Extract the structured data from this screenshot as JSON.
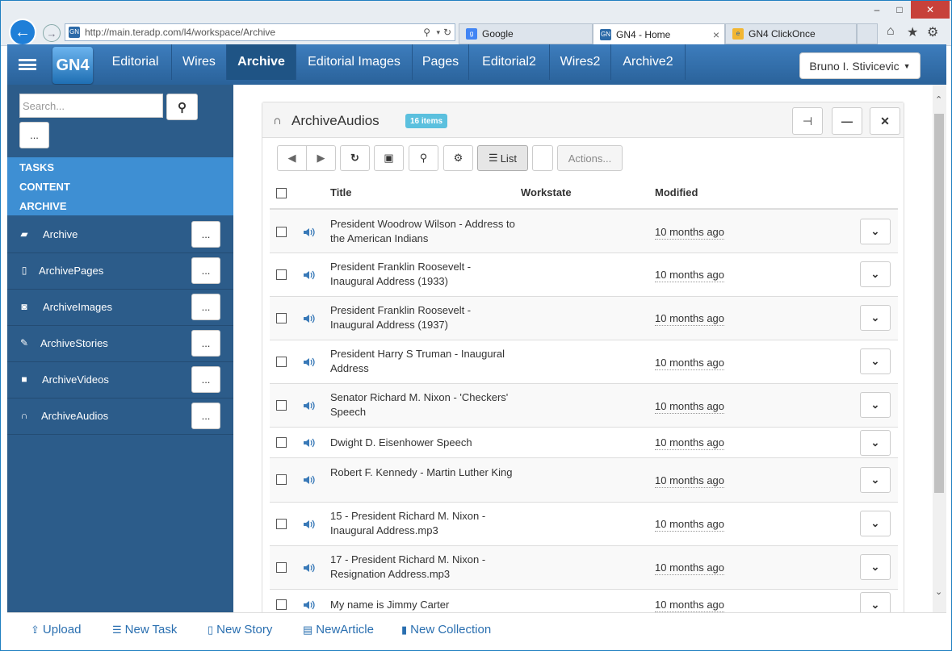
{
  "browser": {
    "url": "http://main.teradp.com/l4/workspace/Archive",
    "tabs": [
      {
        "label": "Google",
        "icon": "google-favicon"
      },
      {
        "label": "GN4 - Home",
        "icon": "gn4-favicon",
        "close": "×"
      },
      {
        "label": "GN4 ClickOnce",
        "icon": "ie-favicon"
      }
    ],
    "window_controls": {
      "minimize": "–",
      "maximize": "□",
      "close": "✕"
    }
  },
  "app": {
    "logo": "GN4",
    "nav": [
      "Editorial",
      "Wires",
      "Archive",
      "Editorial Images",
      "Pages",
      "Editorial2",
      "Wires2",
      "Archive2"
    ],
    "active_nav": "Archive",
    "user": "Bruno I. Stivicevic"
  },
  "sidebar": {
    "search_placeholder": "Search...",
    "more_label": "...",
    "sections": [
      "TASKS",
      "CONTENT",
      "ARCHIVE"
    ],
    "items": [
      {
        "label": "Archive",
        "icon": "folder-open-icon"
      },
      {
        "label": "ArchivePages",
        "icon": "file-icon"
      },
      {
        "label": "ArchiveImages",
        "icon": "camera-icon"
      },
      {
        "label": "ArchiveStories",
        "icon": "pencil-icon"
      },
      {
        "label": "ArchiveVideos",
        "icon": "video-camera-icon"
      },
      {
        "label": "ArchiveAudios",
        "icon": "headphones-icon"
      }
    ]
  },
  "panel": {
    "title": "ArchiveAudios",
    "badge": "16 items",
    "toolbar": {
      "list_label": "List",
      "actions_label": "Actions..."
    },
    "columns": {
      "title": "Title",
      "workstate": "Workstate",
      "modified": "Modified"
    },
    "rows": [
      {
        "title": "President Woodrow Wilson - Address to the American Indians",
        "modified": "10 months ago"
      },
      {
        "title": "President Franklin Roosevelt - Inaugural Address (1933)",
        "modified": "10 months ago"
      },
      {
        "title": "President Franklin Roosevelt - Inaugural Address (1937)",
        "modified": "10 months ago"
      },
      {
        "title": "President Harry S Truman - Inaugural Address",
        "modified": "10 months ago"
      },
      {
        "title": "Senator Richard M. Nixon - 'Checkers' Speech",
        "modified": "10 months ago"
      },
      {
        "title": "Dwight D. Eisenhower Speech",
        "modified": "10 months ago"
      },
      {
        "title": "Robert F. Kennedy - Martin Luther King",
        "modified": "10 months ago"
      },
      {
        "title": "15 - President Richard M. Nixon - Inaugural Address.mp3",
        "modified": "10 months ago"
      },
      {
        "title": "17 - President Richard M. Nixon - Resignation Address.mp3",
        "modified": "10 months ago"
      },
      {
        "title": "My name is Jimmy Carter",
        "modified": "10 months ago"
      }
    ]
  },
  "bottom": {
    "upload": "Upload",
    "new_task": "New Task",
    "new_story": "New Story",
    "new_article": "NewArticle",
    "new_collection": "New Collection"
  },
  "colors": {
    "nav_bg": "#2e6da4",
    "sidebar_bg": "#2c5c8a",
    "sidebar_header": "#3e8fd3",
    "badge": "#5bc0de",
    "link": "#2a6fb0"
  }
}
